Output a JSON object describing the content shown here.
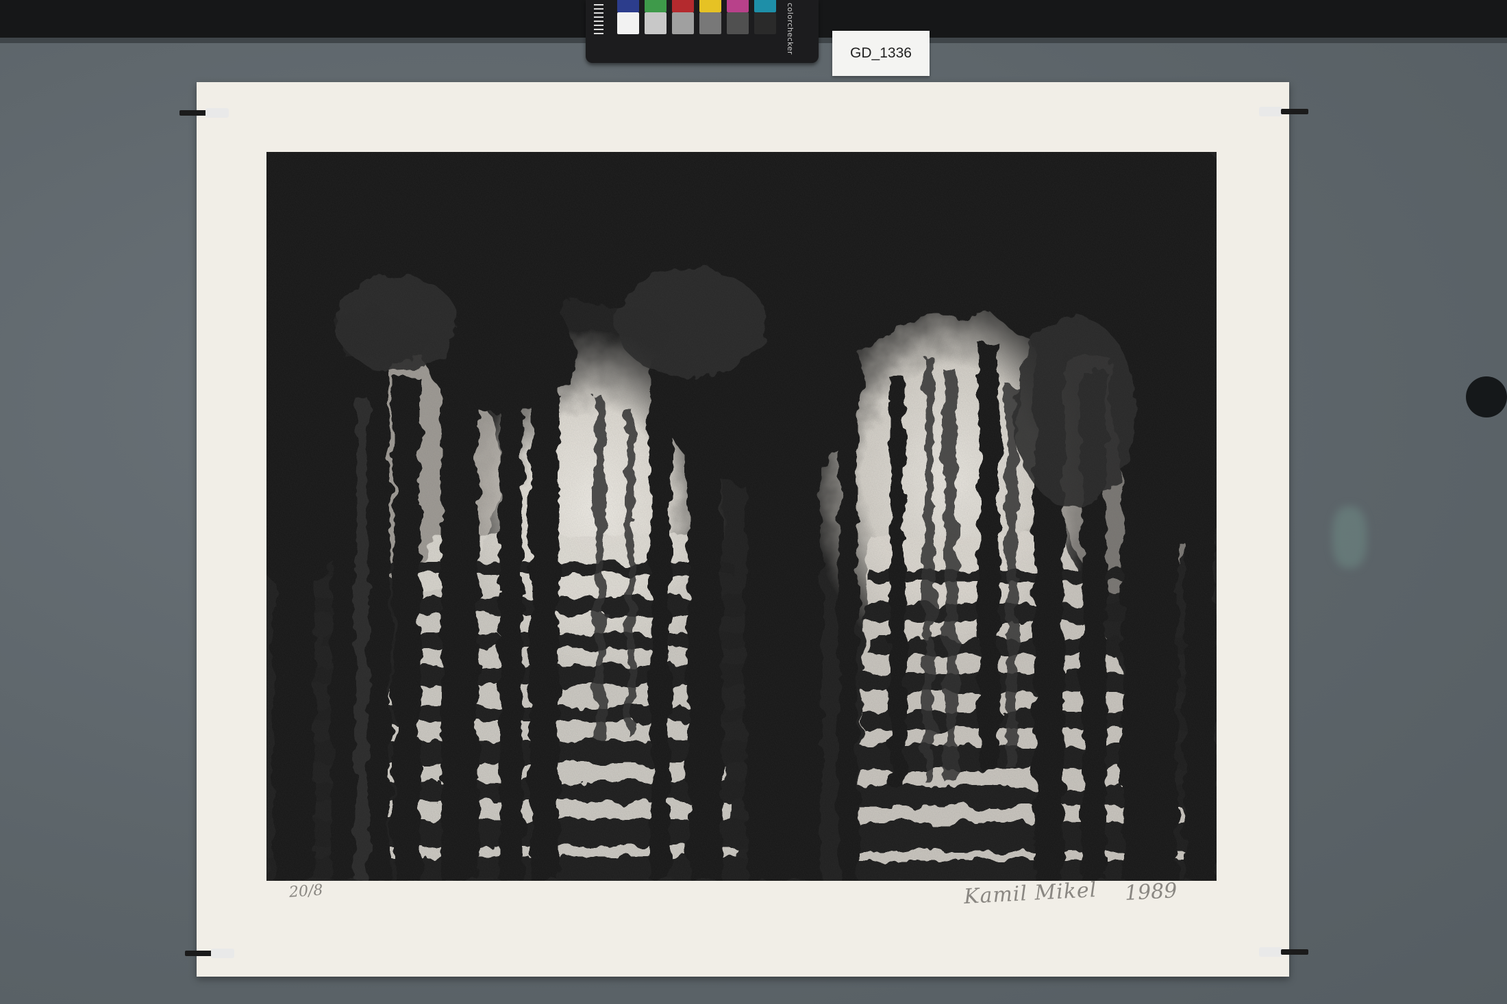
{
  "photo": {
    "subject": "lithograph",
    "background_color": "#5e666c",
    "paper_color": "#f1eee7",
    "ink_color": "#1d1d1d"
  },
  "id_tag": {
    "label": "GD_1336"
  },
  "color_checker": {
    "brand_text": "colorchecker",
    "top_row_colors": [
      "#2c3d8c",
      "#3e9a4a",
      "#b42a2e",
      "#e6c224",
      "#b8418a",
      "#1e8fa8"
    ],
    "bottom_row_colors": [
      "#f2f2f2",
      "#c8c8c8",
      "#a0a0a0",
      "#787878",
      "#505050",
      "#2a2a2a"
    ]
  },
  "print": {
    "edition": "20/8",
    "signature": "Kamil Mikel",
    "year": "1989"
  }
}
